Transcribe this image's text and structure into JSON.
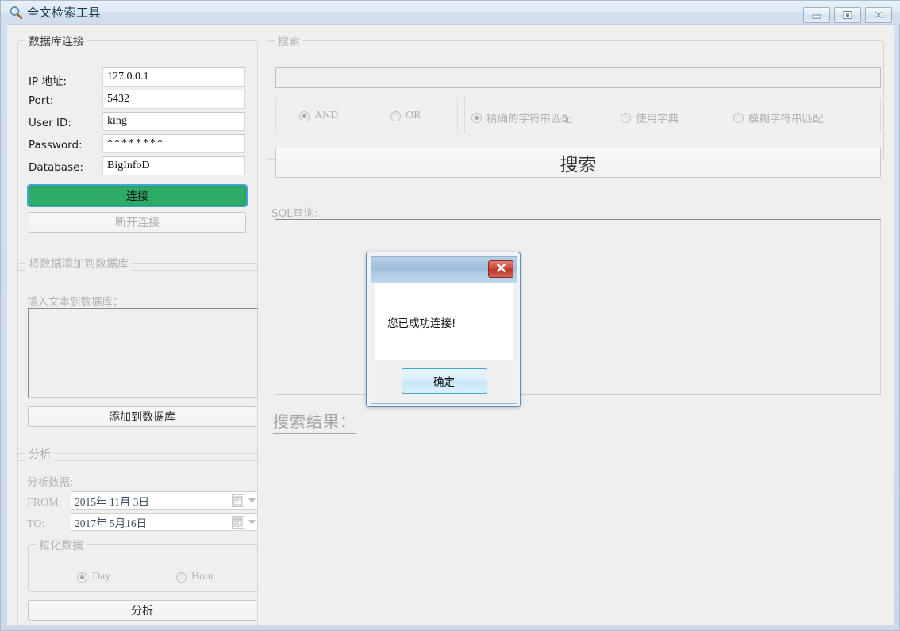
{
  "window": {
    "title": "全文检索工具",
    "icon": "magnifier-icon",
    "controls": {
      "minimize": "minimize-icon",
      "maximize": "restore-icon",
      "close": "close-icon"
    }
  },
  "db_connection": {
    "group_label": "数据库连接",
    "fields": [
      {
        "label": "IP 地址:",
        "value": "127.0.0.1"
      },
      {
        "label": "Port:",
        "value": "5432"
      },
      {
        "label": "User ID:",
        "value": "king"
      },
      {
        "label": "Password:",
        "value": "********"
      },
      {
        "label": "Database:",
        "value": "BigInfoD"
      }
    ],
    "connect_label": "连接",
    "disconnect_label": "断开连接",
    "connect_color": "#2eab66",
    "focus_color": "#40a5d8"
  },
  "add_data": {
    "group_label": "将数据添加到数据库",
    "textarea_label": "插入文本到数据库：",
    "textarea_value": "",
    "add_button_label": "添加到数据库"
  },
  "analysis": {
    "group_label": "分析",
    "data_label": "分析数据:",
    "from_label": "FROM:",
    "from_value": "2015年 11月  3日",
    "to_label": "TO:",
    "to_value": "2017年  5月16日",
    "granularity_group_label": "粒化数据",
    "granularity_options": [
      {
        "label": "Day",
        "selected": true
      },
      {
        "label": "Hour",
        "selected": false
      }
    ],
    "analyze_button_label": "分析"
  },
  "search": {
    "group_label": "搜索",
    "query_value": "",
    "query_placeholder": "",
    "logic_options": [
      {
        "label": "AND",
        "selected": true
      },
      {
        "label": "OR",
        "selected": false
      }
    ],
    "match_options": [
      {
        "label": "精确的字符串匹配",
        "selected": true
      },
      {
        "label": "使用字典",
        "selected": false
      },
      {
        "label": "模糊字符串匹配",
        "selected": false
      }
    ],
    "search_button_label": "搜索",
    "sql_label": "SQL查询:",
    "sql_value": "",
    "results_label": "搜索结果："
  },
  "dialog": {
    "message": "您已成功连接!",
    "ok_label": "确定",
    "close_label": "✕"
  }
}
